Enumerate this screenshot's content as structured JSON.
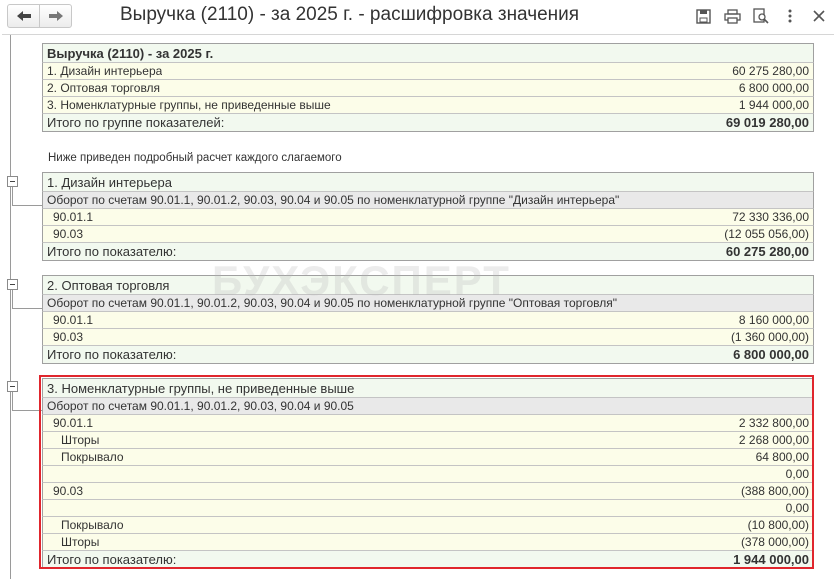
{
  "window": {
    "title": "Выручка (2110) - за 2025 г. - расшифровка значения",
    "icons": [
      "back-arrow-icon",
      "forward-arrow-icon",
      "save-icon",
      "print-icon",
      "preview-icon",
      "more-icon",
      "close-icon"
    ]
  },
  "summary": {
    "title": "Выручка (2110) - за 2025 г.",
    "rows": [
      {
        "label": "1. Дизайн интерьера",
        "value": "60 275 280,00"
      },
      {
        "label": "2. Оптовая торговля",
        "value": "6 800 000,00"
      },
      {
        "label": "3. Номенклатурные группы, не приведенные выше",
        "value": "1 944 000,00"
      }
    ],
    "total_label": "Итого по группе показателей:",
    "total_value": "69 019 280,00"
  },
  "note": "Ниже приведен подробный расчет каждого слагаемого",
  "watermark": "БУХЭКСПЕРТ",
  "sections": [
    {
      "title": "1. Дизайн интерьера",
      "subtitle": "Оборот по счетам 90.01.1, 90.01.2, 90.03, 90.04 и 90.05 по номенклатурной группе \"Дизайн интерьера\"",
      "rows": [
        {
          "label": "90.01.1",
          "value": "72 330 336,00"
        },
        {
          "label": "90.03",
          "value": "(12 055 056,00)"
        }
      ],
      "total_label": "Итого по показателю:",
      "total_value": "60 275 280,00"
    },
    {
      "title": "2. Оптовая торговля",
      "subtitle": "Оборот по счетам 90.01.1, 90.01.2, 90.03, 90.04 и 90.05 по номенклатурной группе \"Оптовая торговля\"",
      "rows": [
        {
          "label": "90.01.1",
          "value": "8 160 000,00"
        },
        {
          "label": "90.03",
          "value": "(1 360 000,00)"
        }
      ],
      "total_label": "Итого по показателю:",
      "total_value": "6 800 000,00"
    },
    {
      "title": "3. Номенклатурные группы, не приведенные выше",
      "subtitle": "Оборот по счетам 90.01.1, 90.01.2, 90.03, 90.04 и 90.05",
      "rows": [
        {
          "label": "90.01.1",
          "value": "2 332 800,00"
        },
        {
          "label": "Шторы",
          "value": "2 268 000,00"
        },
        {
          "label": "Покрывало",
          "value": "64 800,00"
        },
        {
          "label": "",
          "value": "0,00"
        },
        {
          "label": "90.03",
          "value": "(388 800,00)"
        },
        {
          "label": "",
          "value": "0,00"
        },
        {
          "label": "Покрывало",
          "value": "(10 800,00)"
        },
        {
          "label": "Шторы",
          "value": "(378 000,00)"
        }
      ],
      "total_label": "Итого по показателю:",
      "total_value": "1 944 000,00"
    }
  ]
}
